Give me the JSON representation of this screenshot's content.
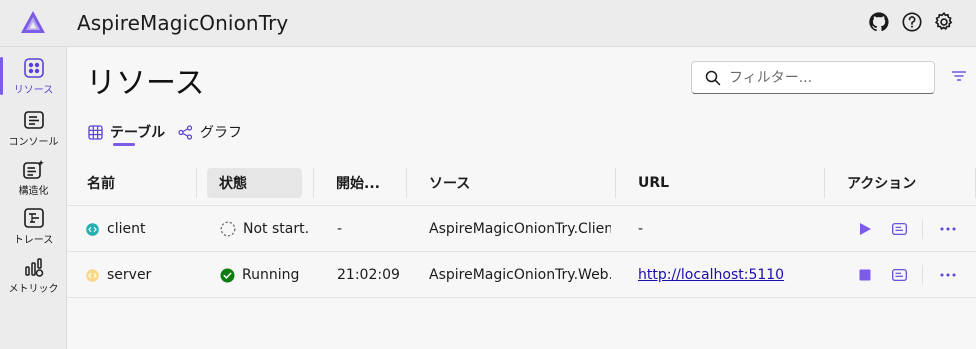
{
  "header": {
    "app_title": "AspireMagicOnionTry"
  },
  "sidebar": {
    "items": [
      {
        "label": "リソース",
        "icon": "resources-icon",
        "active": true
      },
      {
        "label": "コンソール",
        "icon": "console-icon",
        "active": false
      },
      {
        "label": "構造化",
        "icon": "structured-icon",
        "active": false
      },
      {
        "label": "トレース",
        "icon": "traces-icon",
        "active": false
      },
      {
        "label": "メトリック",
        "icon": "metrics-icon",
        "active": false
      }
    ]
  },
  "main": {
    "page_title": "リソース",
    "filter": {
      "placeholder": "フィルター..."
    },
    "tabs": [
      {
        "label": "テーブル",
        "active": true
      },
      {
        "label": "グラフ",
        "active": false
      }
    ],
    "table": {
      "columns": [
        "名前",
        "状態",
        "開始...",
        "ソース",
        "URL",
        "アクション"
      ],
      "rows": [
        {
          "name": "client",
          "state": "Not start...",
          "start": "-",
          "source": "AspireMagicOnionTry.Client....",
          "url": "-",
          "action": "start"
        },
        {
          "name": "server",
          "state": "Running",
          "start": "21:02:09",
          "source": "AspireMagicOnionTry.Web....",
          "url": "http://localhost:5110",
          "action": "stop"
        }
      ]
    }
  },
  "colors": {
    "accent": "#7c5ce7",
    "running": "#107c10",
    "client_icon": "#2bb0b0",
    "server_icon": "#f2c94c"
  }
}
